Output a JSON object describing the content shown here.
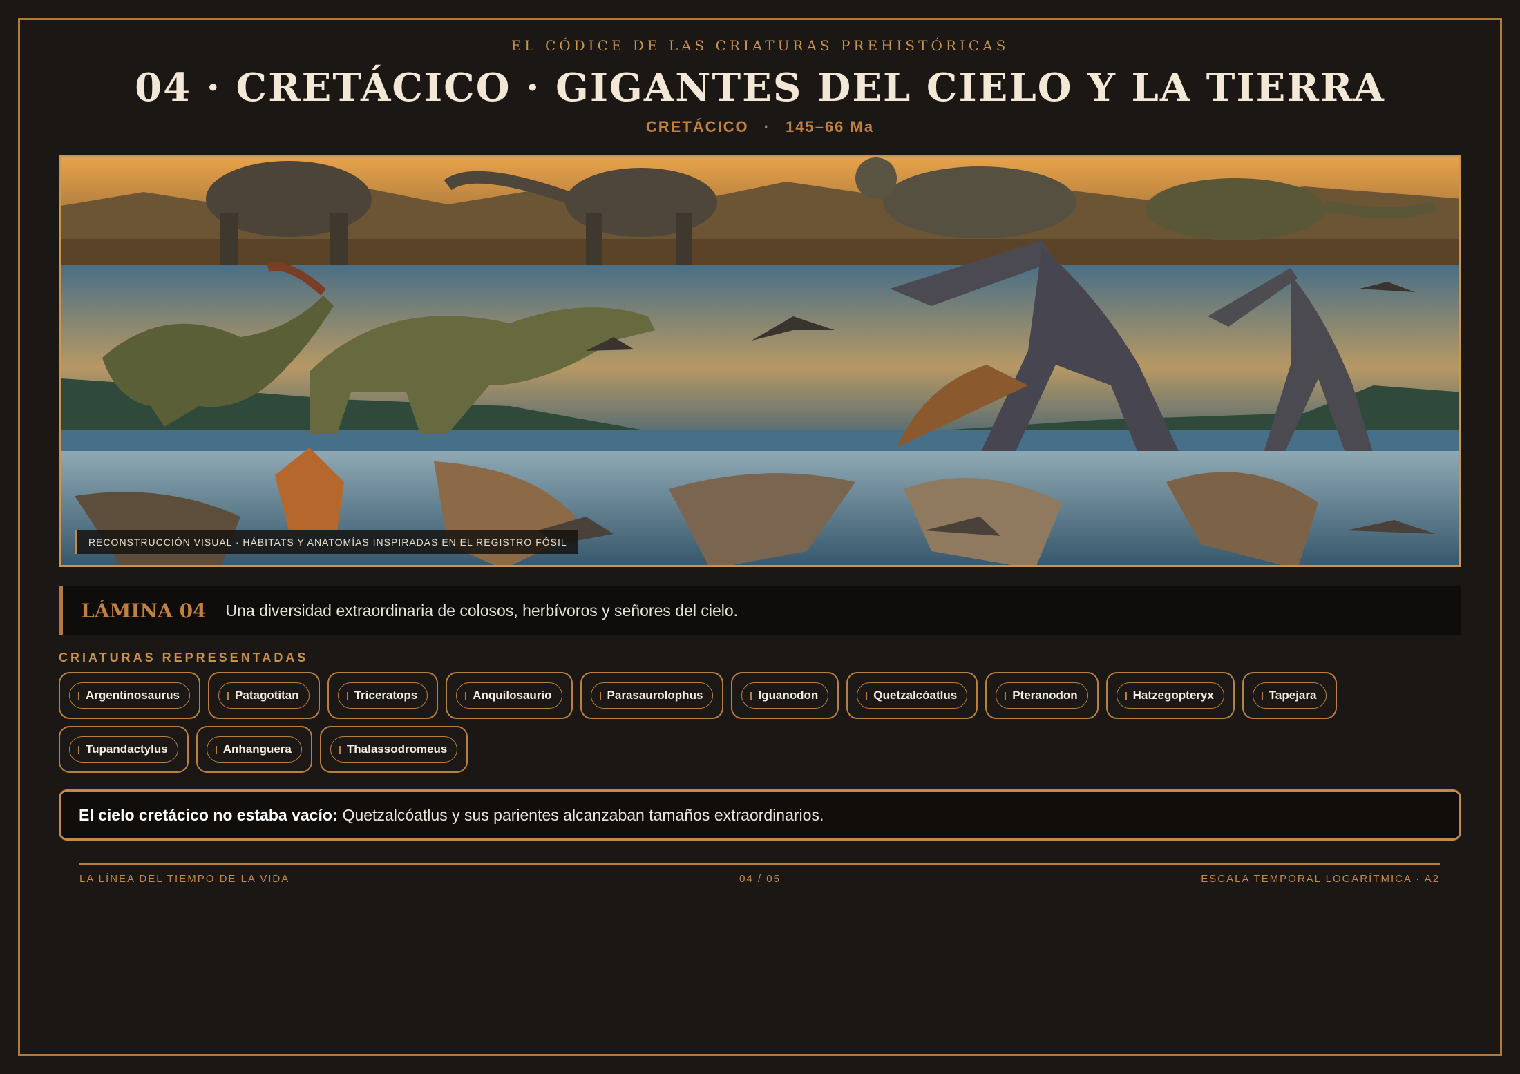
{
  "header": {
    "supertitle": "EL CÓDICE DE LAS CRIATURAS PREHISTÓRICAS",
    "title": "04 · CRETÁCICO · GIGANTES DEL CIELO Y LA TIERRA",
    "period": "CRETÁCICO",
    "separator": "·",
    "range": "145–66 Ma"
  },
  "hero": {
    "caption": "RECONSTRUCCIÓN VISUAL · HÁBITATS Y ANATOMÍAS INSPIRADAS EN EL REGISTRO FÓSIL"
  },
  "plate": {
    "label": "LÁMINA 04",
    "text": "Una diversidad extraordinaria de colosos, herbívoros y señores del cielo."
  },
  "creatures": {
    "heading": "CRIATURAS REPRESENTADAS",
    "items": [
      "Argentinosaurus",
      "Patagotitan",
      "Triceratops",
      "Anquilosaurio",
      "Parasaurolophus",
      "Iguanodon",
      "Quetzalcóatlus",
      "Pteranodon",
      "Hatzegopteryx",
      "Tapejara",
      "Tupandactylus",
      "Anhanguera",
      "Thalassodromeus"
    ]
  },
  "callout": {
    "lead": "El cielo cretácico no estaba vacío:",
    "text": "Quetzalcóatlus y sus parientes alcanzaban tamaños extraordinarios."
  },
  "footer": {
    "left": "LA LÍNEA DEL TIEMPO DE LA VIDA",
    "center": "04 / 05",
    "right": "ESCALA TEMPORAL LOGARÍTMICA · A2"
  },
  "colors": {
    "background": "#1a1715",
    "accent": "#b8803f",
    "title": "#f3e8d6"
  }
}
